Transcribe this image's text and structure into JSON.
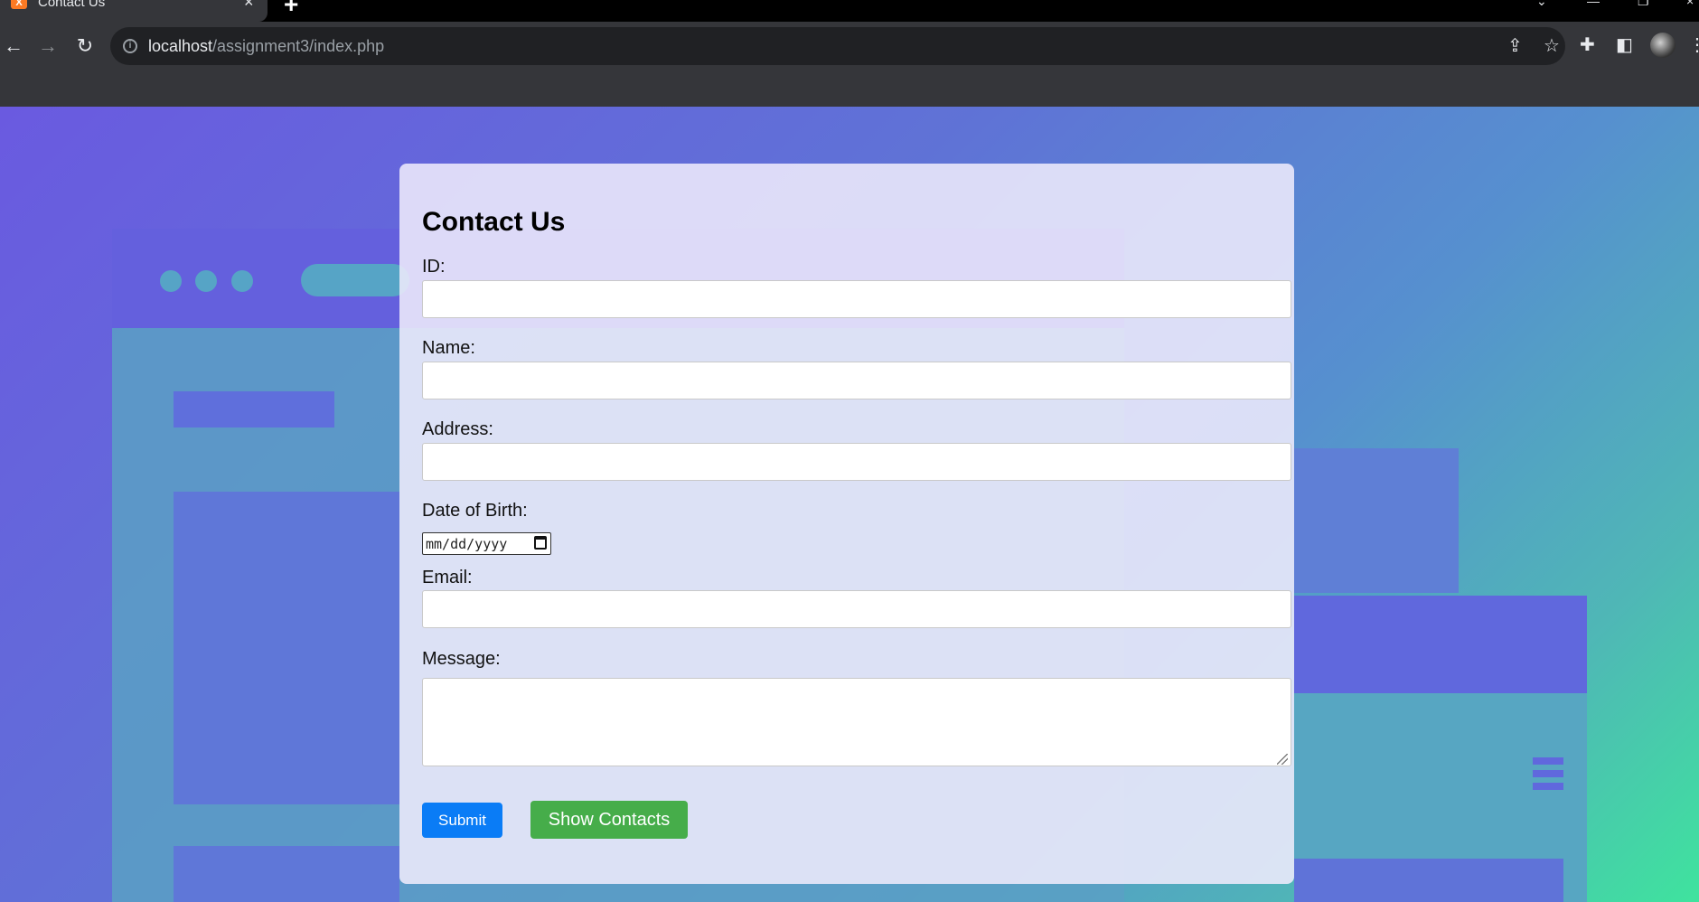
{
  "browser": {
    "tab_title": "Contact Us",
    "tab_favicon_text": "X",
    "new_tab_symbol": "+",
    "url_host": "localhost",
    "url_path": "/assignment3/index.php",
    "icons": [
      "back-arrow-icon",
      "forward-arrow-icon",
      "reload-icon",
      "info-icon",
      "share-icon",
      "star-icon",
      "extensions-icon",
      "side-panel-icon",
      "profile-avatar",
      "menu-icon"
    ]
  },
  "form": {
    "heading": "Contact Us",
    "id_label": "ID:",
    "name_label": "Name:",
    "address_label": "Address:",
    "dob_label": "Date of Birth:",
    "dob_placeholder": "mm/dd/yyyy",
    "email_label": "Email:",
    "message_label": "Message:",
    "submit_label": "Submit",
    "show_contacts_label": "Show Contacts"
  },
  "colors": {
    "submit_button": "#0a7cf6",
    "show_contacts_button": "#46ad4a",
    "card_background": "#eeeafc"
  }
}
